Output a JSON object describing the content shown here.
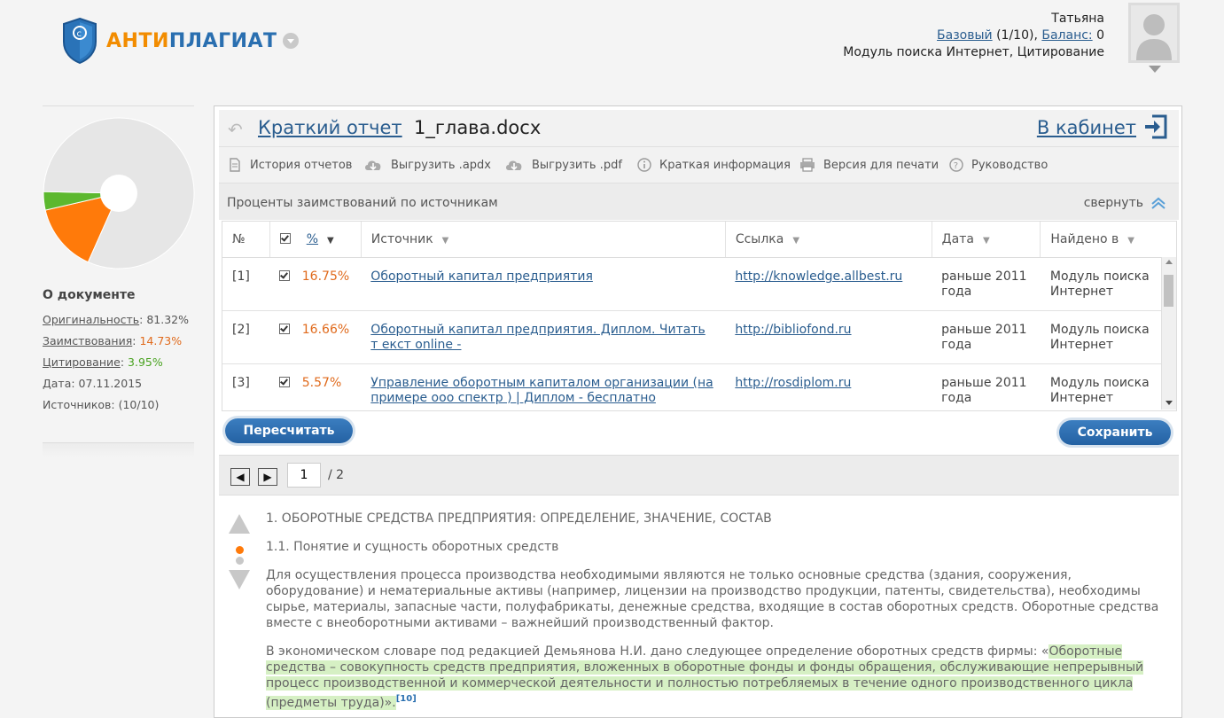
{
  "logo": {
    "part1": "АНТИ",
    "part2": "ПЛАГИАТ"
  },
  "user": {
    "name": "Татьяна",
    "plan_link": "Базовый",
    "plan_count": " (1/10), ",
    "balance_link": "Баланс:",
    "balance_value": " 0",
    "modules": "Модуль поиска Интернет, Цитирование"
  },
  "doc_info": {
    "title": "О документе",
    "originality_label": "Оригинальность",
    "originality_value": "81.32%",
    "borrowing_label": "Заимствования",
    "borrowing_value": "14.73%",
    "citation_label": "Цитирование",
    "citation_value": "3.95%",
    "date": "Дата: 07.11.2015",
    "sources": "Источников: (10/10)"
  },
  "pie_data": {
    "originality": 81.32,
    "borrowing": 14.73,
    "citation": 3.95,
    "colors": {
      "originality": "#e6e6e6",
      "borrowing": "#ff7a0a",
      "citation": "#5cb82e"
    }
  },
  "report": {
    "title": "Краткий отчет",
    "file": "1_глава.docx",
    "cabinet": "В кабинет"
  },
  "toolbar": {
    "history": "История отчетов",
    "export_apdx": "Выгрузить .apdx",
    "export_pdf": "Выгрузить .pdf",
    "short_info": "Краткая информация",
    "print": "Версия для печати",
    "guide": "Руководство"
  },
  "sources_panel": {
    "title": "Проценты заимствований по источникам",
    "collapse": "свернуть"
  },
  "table": {
    "headers": {
      "num": "№",
      "pct": "%",
      "source": "Источник",
      "link": "Ссылка",
      "date": "Дата",
      "found": "Найдено в"
    },
    "rows": [
      {
        "num": "[1]",
        "pct": "16.75%",
        "source": "Оборотный капитал предприятия",
        "link": "http://knowledge.allbest.ru",
        "date": "раньше 2011 года",
        "found": "Модуль поиска Интернет"
      },
      {
        "num": "[2]",
        "pct": "16.66%",
        "source": "Оборотный капитал предприятия. Диплом. Читать т екст online -",
        "link": "http://bibliofond.ru",
        "date": "раньше 2011 года",
        "found": "Модуль поиска Интернет"
      },
      {
        "num": "[3]",
        "pct": "5.57%",
        "source": "Управление оборотным капиталом организации (на примере ооо спектр ) | Диплом - бесплатно",
        "link": "http://rosdiplom.ru",
        "date": "раньше 2011 года",
        "found": "Модуль поиска Интернет"
      }
    ]
  },
  "buttons": {
    "recalc": "Пересчитать",
    "save": "Сохранить"
  },
  "pager": {
    "current": "1",
    "total": "/ 2"
  },
  "text": {
    "heading1": "1. ОБОРОТНЫЕ СРЕДСТВА ПРЕДПРИЯТИЯ: ОПРЕДЕЛЕНИЕ, ЗНАЧЕНИЕ, СОСТАВ",
    "heading2": "1.1. Понятие и сущность оборотных средств",
    "para1": "Для осуществления процесса производства необходимыми являются не только основные средства (здания, сооружения, оборудование) и нематериальные активы (например, лицензии на производство продукции, патенты, свидетельства), необходимы сырье, материалы, запасные части, полуфабрикаты, денежные средства, входящие в состав оборотных средств. Оборотные средства вместе с внеоборотными активами – важнейший производственный фактор.",
    "para2_plain": "В экономическом словаре под редакцией Демьянова Н.И. дано следующее определение оборотных средств фирмы: «",
    "para2_highlight": "Оборотные средства – совокупность средств предприятия, вложенных в оборотные фонды и фонды обращения, обслуживающие непрерывный процесс производственной и коммерческой деятельности и полностью потребляемых в течение одного производственного цикла (предметы труда)».",
    "para2_ref": "[10]"
  }
}
